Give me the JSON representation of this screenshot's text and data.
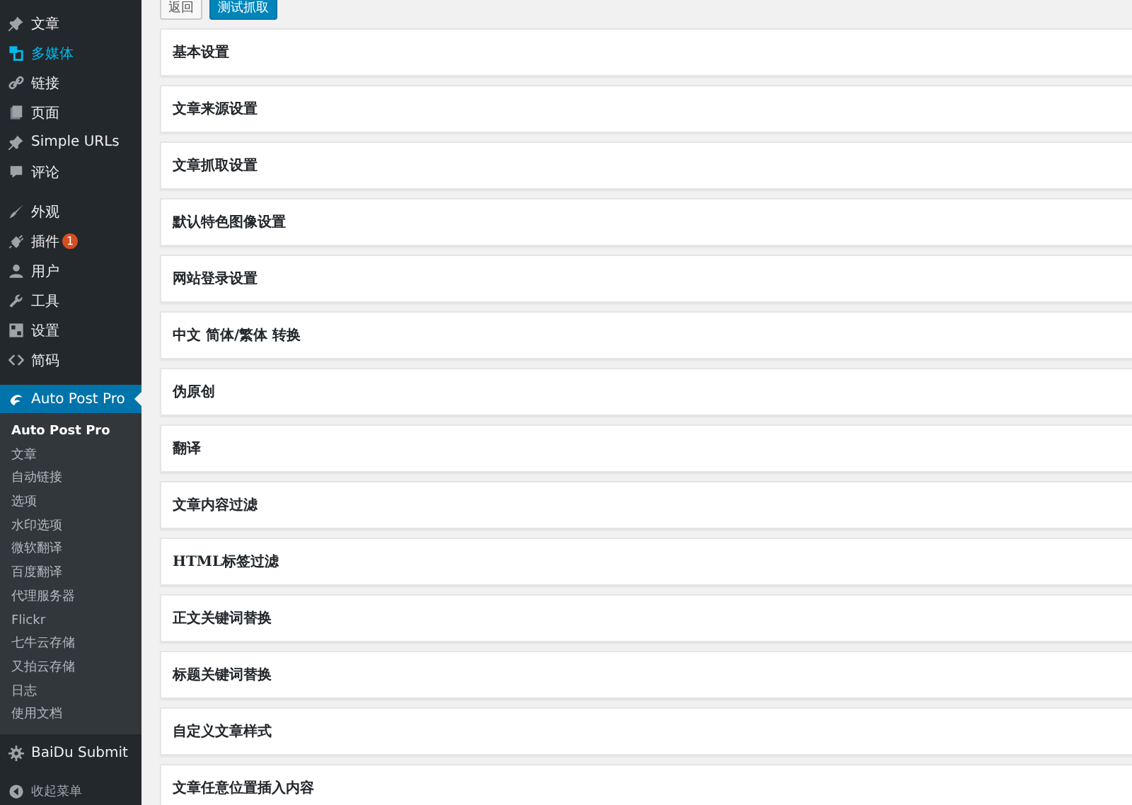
{
  "sidebar": {
    "groups": [
      {
        "items": [
          {
            "label": "文章",
            "highlighted": false,
            "selected": false
          },
          {
            "label": "多媒体",
            "highlighted": true,
            "selected": false
          },
          {
            "label": "链接",
            "highlighted": false,
            "selected": false
          },
          {
            "label": "页面",
            "highlighted": false,
            "selected": false
          },
          {
            "label": "Simple URLs",
            "highlighted": false,
            "selected": false
          },
          {
            "label": "评论",
            "highlighted": false,
            "selected": false
          }
        ]
      },
      {
        "items": [
          {
            "label": "外观",
            "highlighted": false,
            "selected": false
          },
          {
            "label": "插件",
            "highlighted": false,
            "selected": false,
            "badge": "1"
          },
          {
            "label": "用户",
            "highlighted": false,
            "selected": false
          },
          {
            "label": "工具",
            "highlighted": false,
            "selected": false
          },
          {
            "label": "设置",
            "highlighted": false,
            "selected": false
          },
          {
            "label": "简码",
            "highlighted": false,
            "selected": false
          }
        ]
      },
      {
        "items": [
          {
            "label": "Auto Post Pro",
            "highlighted": false,
            "selected": true,
            "submenu": [
              {
                "label": "Auto Post Pro",
                "selected": true
              },
              {
                "label": "文章",
                "selected": false
              },
              {
                "label": "自动链接",
                "selected": false
              },
              {
                "label": "选项",
                "selected": false
              },
              {
                "label": "水印选项",
                "selected": false
              },
              {
                "label": "微软翻译",
                "selected": false
              },
              {
                "label": "百度翻译",
                "selected": false
              },
              {
                "label": "代理服务器",
                "selected": false
              },
              {
                "label": "Flickr",
                "selected": false
              },
              {
                "label": "七牛云存储",
                "selected": false
              },
              {
                "label": "又拍云存储",
                "selected": false
              },
              {
                "label": "日志",
                "selected": false
              },
              {
                "label": "使用文档",
                "selected": false
              }
            ]
          },
          {
            "label": "BaiDu Submit",
            "highlighted": false,
            "selected": false
          }
        ]
      }
    ],
    "collapse": {
      "label": "收起菜单"
    }
  },
  "toolbar": {
    "buttons": [
      {
        "label": "返回",
        "kind": "secondary"
      },
      {
        "label": "测试抓取",
        "kind": "primary"
      }
    ]
  },
  "sections": [
    "基本设置",
    "文章来源设置",
    "文章抓取设置",
    "默认特色图像设置",
    "网站登录设置",
    "中文 简体/繁体 转换",
    "伪原创",
    "翻译",
    "文章内容过滤",
    "HTML标签过滤",
    "正文关键词替换",
    "标题关键词替换",
    "自定义文章样式",
    "文章任意位置插入内容"
  ]
}
